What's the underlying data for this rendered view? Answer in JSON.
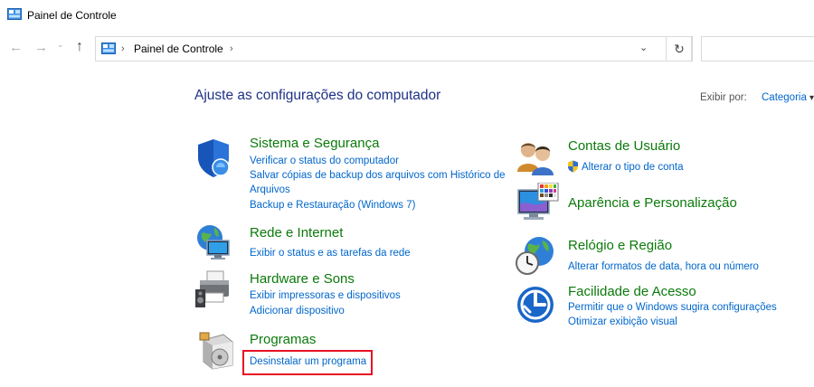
{
  "window": {
    "title": "Painel de Controle"
  },
  "nav": {
    "back": "←",
    "forward": "→",
    "recent": "⌄",
    "up": "↑",
    "breadcrumb": [
      "Painel de Controle"
    ],
    "separator": "›",
    "dropdown": "⌄",
    "refresh": "↻",
    "search_placeholder": ""
  },
  "main": {
    "heading": "Ajuste as configurações do computador",
    "view_by": {
      "label": "Exibir por:",
      "value": "Categoria",
      "arrow": "▾"
    },
    "left_categories": [
      {
        "icon": "shield-icon",
        "title": "Sistema e Segurança",
        "links": [
          "Verificar o status do computador",
          "Salvar cópias de backup dos arquivos com Histórico de Arquivos",
          "Backup e Restauração (Windows 7)"
        ]
      },
      {
        "icon": "network-globe-icon",
        "title": "Rede e Internet",
        "links": [
          "Exibir o status e as tarefas da rede"
        ]
      },
      {
        "icon": "printer-speaker-icon",
        "title": "Hardware e Sons",
        "links": [
          "Exibir impressoras e dispositivos",
          "Adicionar dispositivo"
        ]
      },
      {
        "icon": "programs-disc-icon",
        "title": "Programas",
        "links": [
          "Desinstalar um programa"
        ]
      }
    ],
    "right_categories": [
      {
        "icon": "users-icon",
        "title": "Contas de Usuário",
        "links": [
          "Alterar o tipo de conta"
        ]
      },
      {
        "icon": "appearance-monitor-icon",
        "title": "Aparência e Personalização",
        "links": []
      },
      {
        "icon": "clock-globe-icon",
        "title": "Relógio e Região",
        "links": [
          "Alterar formatos de data, hora ou número"
        ]
      },
      {
        "icon": "accessibility-icon",
        "title": "Facilidade de Acesso",
        "links": [
          "Permitir que o Windows sugira configurações",
          "Otimizar exibição visual"
        ]
      }
    ]
  }
}
